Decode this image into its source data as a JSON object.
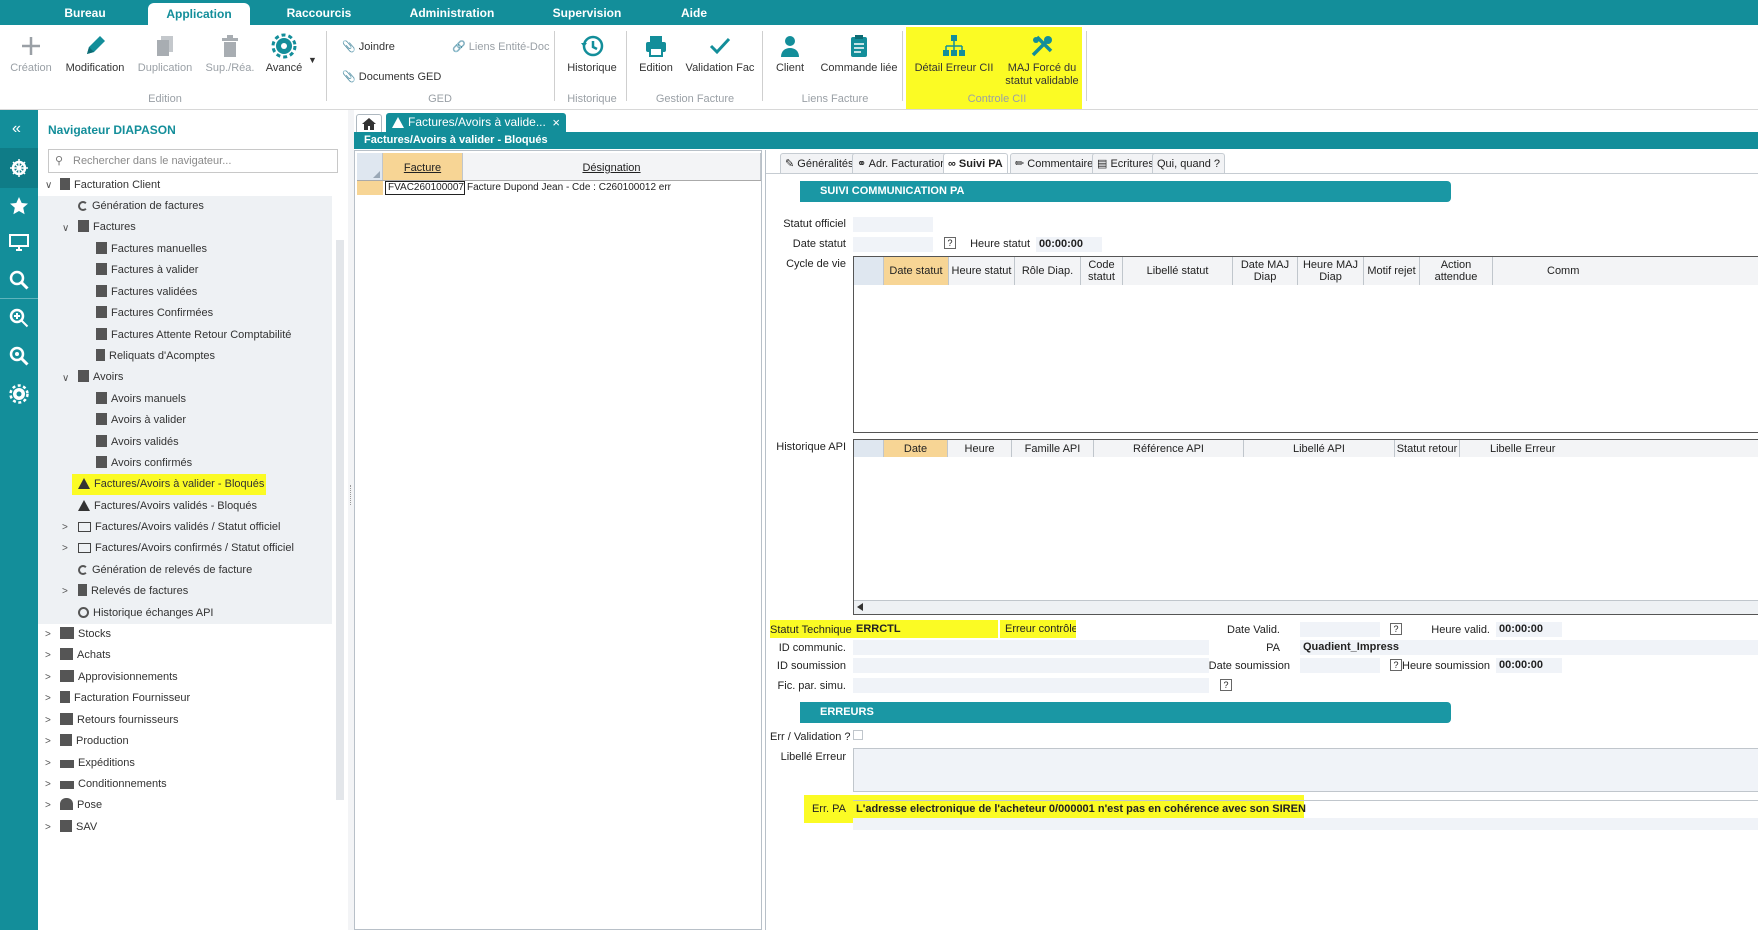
{
  "menubar": {
    "tabs": [
      "Bureau",
      "Application",
      "Raccourcis",
      "Administration",
      "Supervision",
      "Aide"
    ],
    "active": "Application"
  },
  "ribbon": {
    "creation": "Création",
    "modification": "Modification",
    "duplication": "Duplication",
    "sup": "Sup./Réa.",
    "avance": "Avancé",
    "group_edition": "Edition",
    "joindre": "Joindre",
    "liens": "Liens Entité-Doc",
    "documents": "Documents GED",
    "group_ged": "GED",
    "historique": "Historique",
    "group_historique": "Historique",
    "edition": "Edition",
    "validation": "Validation Fac",
    "group_gestion": "Gestion Facture",
    "client": "Client",
    "commande": "Commande liée",
    "group_liens": "Liens Facture",
    "detail": "Détail Erreur CII",
    "maj1": "MAJ Forcé du",
    "maj2": "statut validable",
    "group_controle": "Controle CII"
  },
  "nav": {
    "title": "Navigateur DIAPASON",
    "search_placeholder": "Rechercher dans le navigateur...",
    "items": [
      "Facturation Client",
      "Génération de factures",
      "Factures",
      "Factures manuelles",
      "Factures à valider",
      "Factures validées",
      "Factures Confirmées",
      "Factures Attente Retour Comptabilité",
      "Reliquats d'Acomptes",
      "Avoirs",
      "Avoirs manuels",
      "Avoirs à valider",
      "Avoirs validés",
      "Avoirs confirmés",
      "Factures/Avoirs à valider - Bloqués",
      "Factures/Avoirs validés - Bloqués",
      "Factures/Avoirs validés / Statut officiel",
      "Factures/Avoirs confirmés / Statut officiel",
      "Génération de relevés de facture",
      "Relevés de factures",
      "Historique échanges API",
      "Stocks",
      "Achats",
      "Approvisionnements",
      "Facturation Fournisseur",
      "Retours fournisseurs",
      "Production",
      "Expéditions",
      "Conditionnements",
      "Pose",
      "SAV"
    ]
  },
  "doc": {
    "tab": "Factures/Avoirs à valide...",
    "subtitle": "Factures/Avoirs à valider - Bloqués"
  },
  "list": {
    "headers": [
      "Facture",
      "Désignation"
    ],
    "rows": [
      {
        "facture": "FVAC260100007",
        "designation": "Facture Dupond Jean - Cde : C260100012 err"
      }
    ]
  },
  "rtabs": [
    "Généralités",
    "Adr. Facturation",
    "Suivi PA",
    "Commentaire",
    "Ecritures",
    "Qui, quand ?"
  ],
  "suivi": {
    "section": "SUIVI COMMUNICATION PA",
    "statut_officiel": "Statut officiel",
    "date_statut": "Date statut",
    "heure_statut_label": "Heure statut",
    "heure_statut_value": "00:00:00",
    "cycle_label": "Cycle de vie",
    "cycle_headers": [
      "Date statut",
      "Heure statut",
      "Rôle Diap.",
      "Code statut",
      "Libellé statut",
      "Date MAJ Diap",
      "Heure MAJ Diap",
      "Motif rejet",
      "Action attendue",
      "Comm"
    ],
    "histo_label": "Historique API",
    "histo_headers": [
      "Date",
      "Heure",
      "Famille API",
      "Référence API",
      "Libellé API",
      "Statut retour",
      "Libelle Erreur"
    ],
    "statut_tech_label": "Statut Technique",
    "statut_tech_code": "ERRCTL",
    "statut_tech_text": "Erreur contrôle",
    "date_valid": "Date Valid.",
    "heure_valid_label": "Heure valid.",
    "heure_valid_value": "00:00:00",
    "id_communic": "ID communic.",
    "pa_label": "PA",
    "pa_value": "Quadient_Impress",
    "id_soumission": "ID soumission",
    "date_soumission": "Date soumission",
    "heure_soumission_label": "Heure soumission",
    "heure_soumission_value": "00:00:00",
    "fic_simu": "Fic. par. simu.",
    "q": "?"
  },
  "erreurs": {
    "section": "ERREURS",
    "err_validation": "Err / Validation ?",
    "libelle_erreur": "Libellé Erreur",
    "err_pa_label": "Err. PA",
    "err_pa_value": "L'adresse electronique de l'acheteur 0/000001 n'est pas en cohérence avec son SIREN"
  },
  "colors": {
    "teal": "#138e9a",
    "highlight": "#fbfb24",
    "selected_header": "#f7d595"
  }
}
